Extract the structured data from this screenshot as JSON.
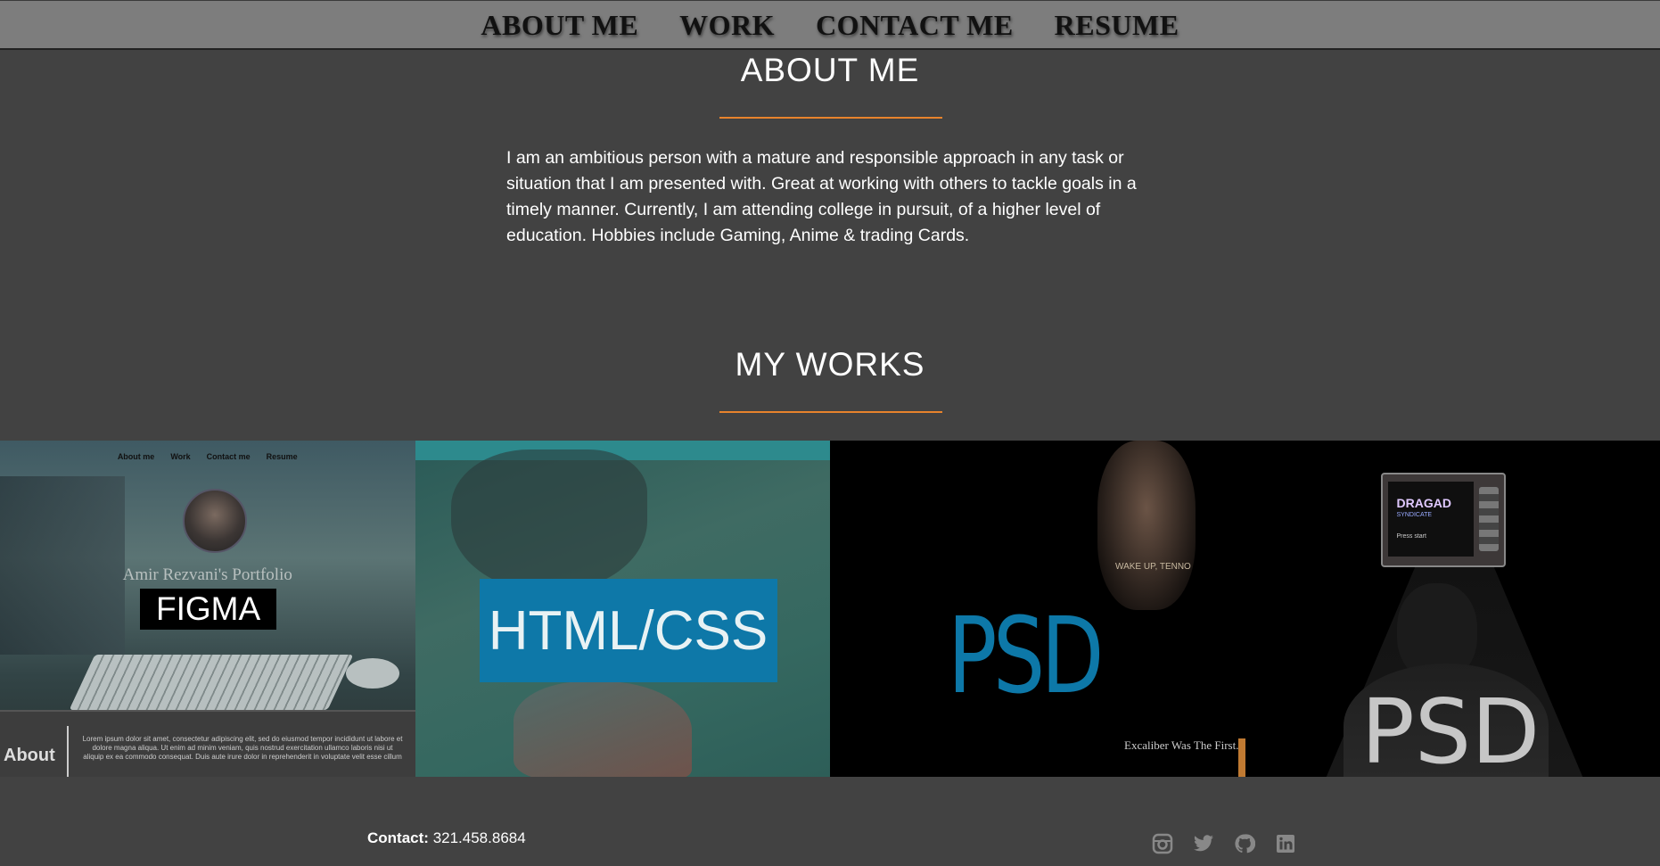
{
  "nav": {
    "items": [
      "ABOUT ME",
      "WORK",
      "CONTACT ME",
      "RESUME"
    ]
  },
  "about": {
    "title": "ABOUT ME",
    "text": "I am an ambitious person with a mature and responsible approach in any task or situation that I am presented with. Great at working with others to tackle goals in a timely manner. Currently, I am attending college in pursuit, of a higher level of education. Hobbies include Gaming, Anime & trading Cards."
  },
  "works": {
    "title": "MY WORKS",
    "tiles": [
      {
        "label": "FIGMA",
        "mini_nav": [
          "About me",
          "Work",
          "Contact me",
          "Resume"
        ],
        "portfolio_name": "Amir Rezvani's Portfolio",
        "about_heading": "About",
        "lorem": "Lorem ipsum dolor sit amet, consectetur adipiscing elit, sed do eiusmod tempor incididunt ut labore et dolore magna aliqua. Ut enim ad minim veniam, quis nostrud exercitation ullamco laboris nisi ut aliquip ex ea commodo consequat. Duis aute irure dolor in reprehenderit in voluptate velit esse cillum"
      },
      {
        "label": "HTML/CSS"
      },
      {
        "label": "PSD",
        "caption_small": "WAKE UP, TENNO",
        "caption": "Excaliber Was The First."
      },
      {
        "label": "PSD",
        "tv_title": "DRAGAD",
        "tv_sub": "SYNDICATE",
        "tv_press": "Press start"
      }
    ]
  },
  "footer": {
    "contact_label": "Contact:",
    "contact_value": "321.458.8684",
    "social_icons": [
      "instagram-icon",
      "twitter-icon",
      "github-icon",
      "linkedin-icon"
    ]
  },
  "colors": {
    "background": "#424242",
    "nav_bg": "#7d7d7d",
    "accent_rule": "#e8832c",
    "tile_blue": "#0e78a8"
  }
}
